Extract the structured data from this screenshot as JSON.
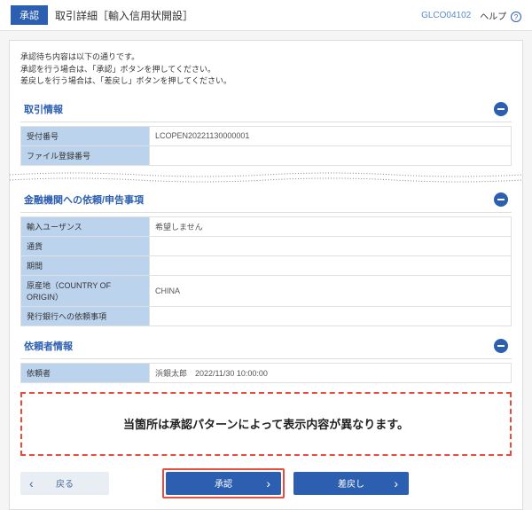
{
  "header": {
    "tag": "承認",
    "title": "取引詳細［輸入信用状開設］",
    "code": "GLCO04102",
    "help": "ヘルプ"
  },
  "intro": {
    "line1": "承認待ち内容は以下の通りです。",
    "line2": "承認を行う場合は、「承認」ボタンを押してください。",
    "line3": "差戻しを行う場合は、「差戻し」ボタンを押してください。"
  },
  "section1": {
    "title": "取引情報",
    "rows": {
      "r1_label": "受付番号",
      "r1_value": "LCOPEN20221130000001",
      "r2_label": "ファイル登録番号",
      "r2_value": ""
    }
  },
  "section2": {
    "title": "金融機関への依頼/申告事項",
    "rows": {
      "r1_label": "輸入ユーザンス",
      "r1_value": "希望しません",
      "r2_label": "通貨",
      "r2_value": "",
      "r3_label": "期間",
      "r3_value": "",
      "r4_label": "原産地（COUNTRY OF ORIGIN）",
      "r4_value": "CHINA",
      "r5_label": "発行銀行への依頼事項",
      "r5_value": ""
    }
  },
  "section3": {
    "title": "依頼者情報",
    "rows": {
      "r1_label": "依頼者",
      "r1_value": "浜銀太郎　2022/11/30 10:00:00"
    }
  },
  "notice": "当箇所は承認パターンによって表示内容が異なります。",
  "buttons": {
    "back": "戻る",
    "approve": "承認",
    "reject": "差戻し"
  }
}
